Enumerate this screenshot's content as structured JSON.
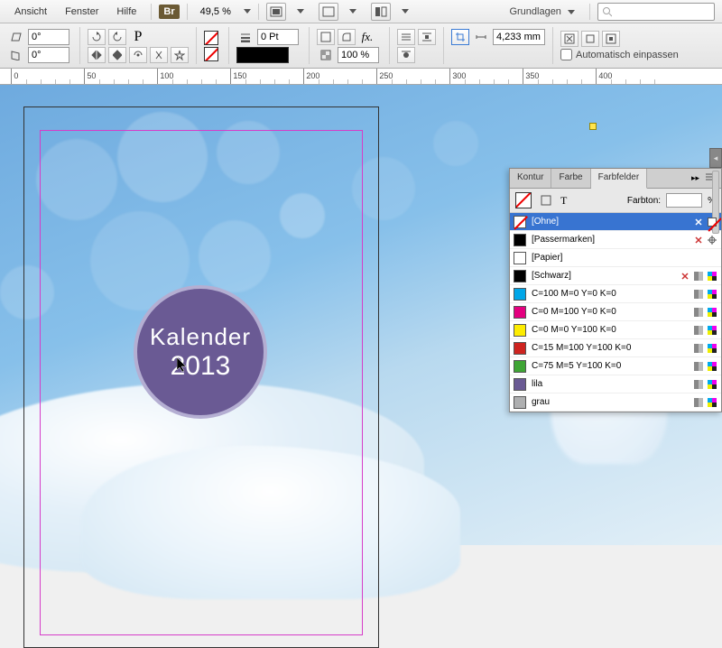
{
  "menu": {
    "ansicht": "Ansicht",
    "fenster": "Fenster",
    "hilfe": "Hilfe"
  },
  "br_badge": "Br",
  "zoom": "49,5 %",
  "workspace": "Grundlagen",
  "angle": {
    "a": "0°",
    "b": "0°"
  },
  "stroke_weight": "0 Pt",
  "scale_pct": "100 %",
  "frame_w": "4,233 mm",
  "autofit": "Automatisch einpassen",
  "ruler_ticks": [
    0,
    50,
    100,
    150,
    200,
    250,
    300,
    350,
    400
  ],
  "document": {
    "title_l1": "Kalender",
    "title_l2": "2013"
  },
  "panel": {
    "tabs": {
      "kontur": "Kontur",
      "farbe": "Farbe",
      "farbfelder": "Farbfelder"
    },
    "tint_label": "Farbton:",
    "tint_unit": "%",
    "swatches": [
      {
        "name": "[Ohne]",
        "color": "none",
        "selected": true,
        "lock": true,
        "none": true
      },
      {
        "name": "[Passermarken]",
        "color": "#000",
        "reg": true,
        "lock": true
      },
      {
        "name": "[Papier]",
        "color": "#fff"
      },
      {
        "name": "[Schwarz]",
        "color": "#000",
        "lock": true,
        "cmyk": true
      },
      {
        "name": "C=100 M=0 Y=0 K=0",
        "color": "#00a6e8",
        "cmyk": true
      },
      {
        "name": "C=0 M=100 Y=0 K=0",
        "color": "#e4007f",
        "cmyk": true
      },
      {
        "name": "C=0 M=0 Y=100 K=0",
        "color": "#fdec00",
        "cmyk": true
      },
      {
        "name": "C=15 M=100 Y=100 K=0",
        "color": "#ce2420",
        "cmyk": true
      },
      {
        "name": "C=75 M=5 Y=100 K=0",
        "color": "#3fa535",
        "cmyk": true
      },
      {
        "name": "lila",
        "color": "#6a5a94",
        "cmyk": true
      },
      {
        "name": "grau",
        "color": "#aeafb0",
        "cmyk": true
      }
    ]
  }
}
